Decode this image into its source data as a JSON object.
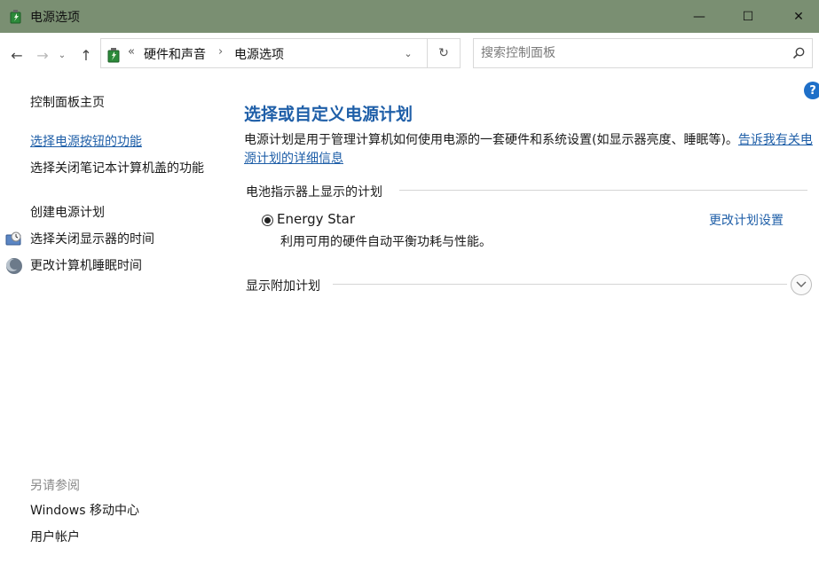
{
  "window": {
    "title": "电源选项",
    "minimize_glyph": "—",
    "maximize_glyph": "☐",
    "close_glyph": "✕"
  },
  "navbar": {
    "back_glyph": "←",
    "forward_glyph": "→",
    "recent_glyph": "⌄",
    "up_glyph": "↑",
    "breadcrumb": {
      "prefix": "«",
      "items": [
        "硬件和声音",
        "电源选项"
      ],
      "separator": "›"
    },
    "dropdown_glyph": "⌄",
    "refresh_glyph": "↻",
    "search_placeholder": "搜索控制面板"
  },
  "sidebar": {
    "home": "控制面板主页",
    "tasks": [
      "选择电源按钮的功能",
      "选择关闭笔记本计算机盖的功能",
      "创建电源计划",
      "选择关闭显示器的时间",
      "更改计算机睡眠时间"
    ],
    "see_also_header": "另请参阅",
    "see_also": [
      "Windows 移动中心",
      "用户帐户"
    ]
  },
  "main": {
    "help_glyph": "?",
    "title": "选择或自定义电源计划",
    "description": "电源计划是用于管理计算机如何使用电源的一套硬件和系统设置(如显示器亮度、睡眠等)。",
    "description_link": "告诉我有关电源计划的详细信息",
    "section_battery": "电池指示器上显示的计划",
    "plan": {
      "name": "Energy Star",
      "description": "利用可用的硬件自动平衡功耗与性能。",
      "settings_link": "更改计划设置",
      "selected": true
    },
    "section_additional": "显示附加计划"
  },
  "colors": {
    "titlebar": "#7a8f72",
    "link": "#1f5fa8",
    "help": "#1e6fc8"
  }
}
